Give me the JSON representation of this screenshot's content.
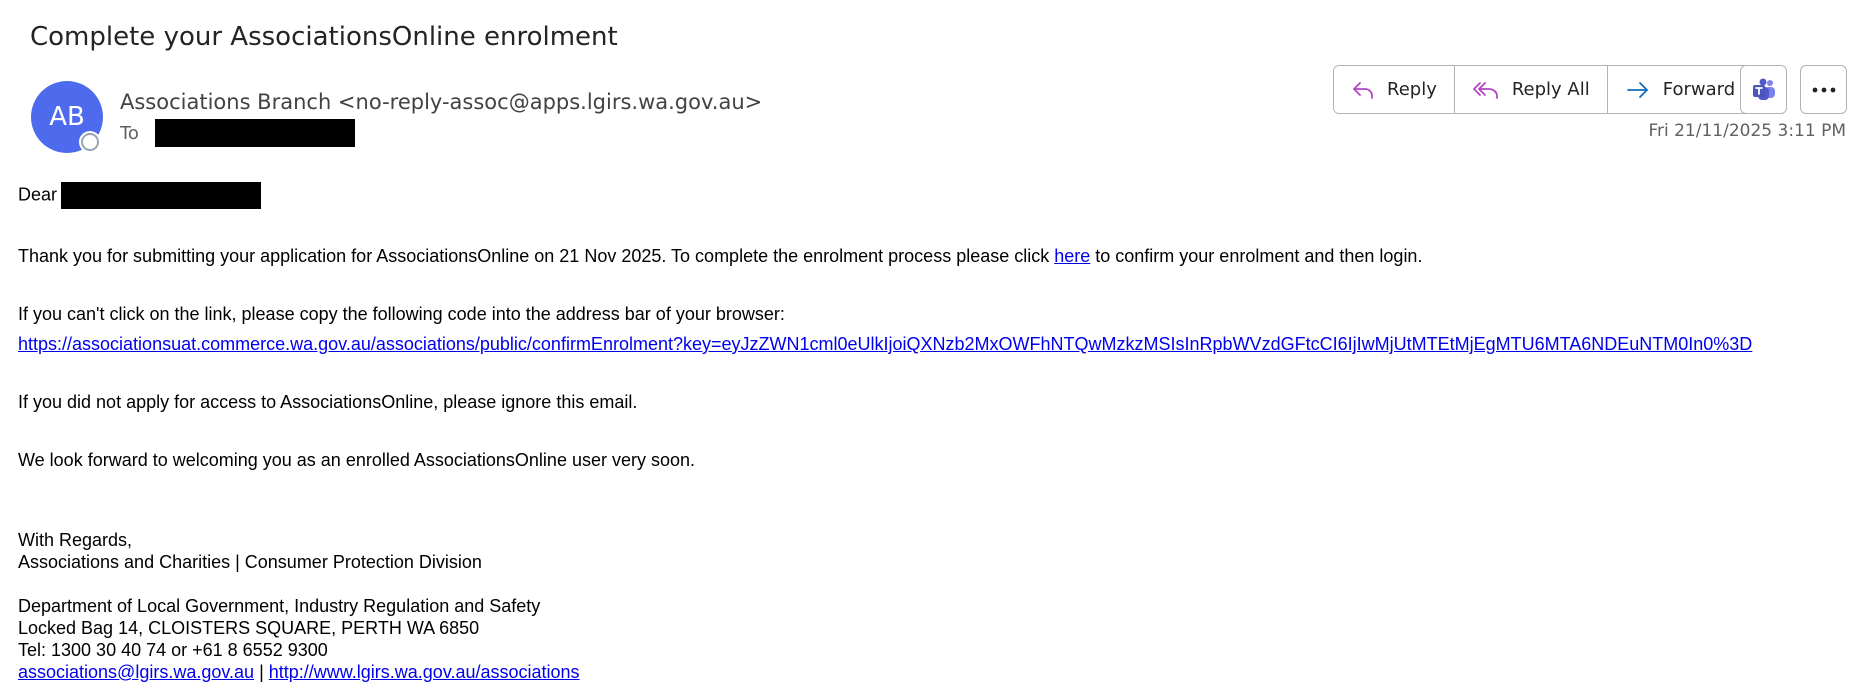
{
  "email": {
    "subject": "Complete your AssociationsOnline enrolment",
    "avatar_initials": "AB",
    "sender": "Associations Branch <no-reply-assoc@apps.lgirs.wa.gov.au>",
    "to_label": "To",
    "timestamp": "Fri 21/11/2025 3:11 PM"
  },
  "toolbar": {
    "reply_label": "Reply",
    "reply_all_label": "Reply All",
    "forward_label": "Forward"
  },
  "body": {
    "greeting": "Dear",
    "p1_before": "Thank you for submitting your application for AssociationsOnline on 21 Nov 2025. To complete the enrolment process please click ",
    "p1_link": "here",
    "p1_after": " to confirm your enrolment and then login.",
    "p2": "If you can't click on the link, please copy the following code into the address bar of your browser:",
    "confirm_url": "https://associationsuat.commerce.wa.gov.au/associations/public/confirmEnrolment?key=eyJzZWN1cml0eUlkIjoiQXNzb2MxOWFhNTQwMzkzMSIsInRpbWVzdGFtcCI6IjIwMjUtMTEtMjEgMTU6MTA6NDEuNTM0In0%3D",
    "p3": "If you did not apply for access to AssociationsOnline, please ignore this email.",
    "p4": "We look forward to welcoming you as an enrolled AssociationsOnline user very soon.",
    "regards": "With Regards,",
    "division": "Associations and Charities | Consumer Protection Division",
    "department": "Department of Local Government, Industry Regulation and Safety",
    "address": "Locked Bag 14, CLOISTERS SQUARE, PERTH WA 6850",
    "tel": "Tel: 1300 30 40 74 or +61 8 6552 9300",
    "email_link": "associations@lgirs.wa.gov.au",
    "separator": " | ",
    "web_link": "http://www.lgirs.wa.gov.au/associations"
  },
  "colors": {
    "avatar_bg": "#4f6bed",
    "reply_icon": "#b146c2",
    "forward_icon": "#0f6cbd",
    "link": "#0000ee"
  },
  "icons": {
    "reply": "reply-icon",
    "reply_all": "reply-all-icon",
    "forward": "forward-icon",
    "teams": "teams-icon",
    "more": "more-options-icon"
  }
}
